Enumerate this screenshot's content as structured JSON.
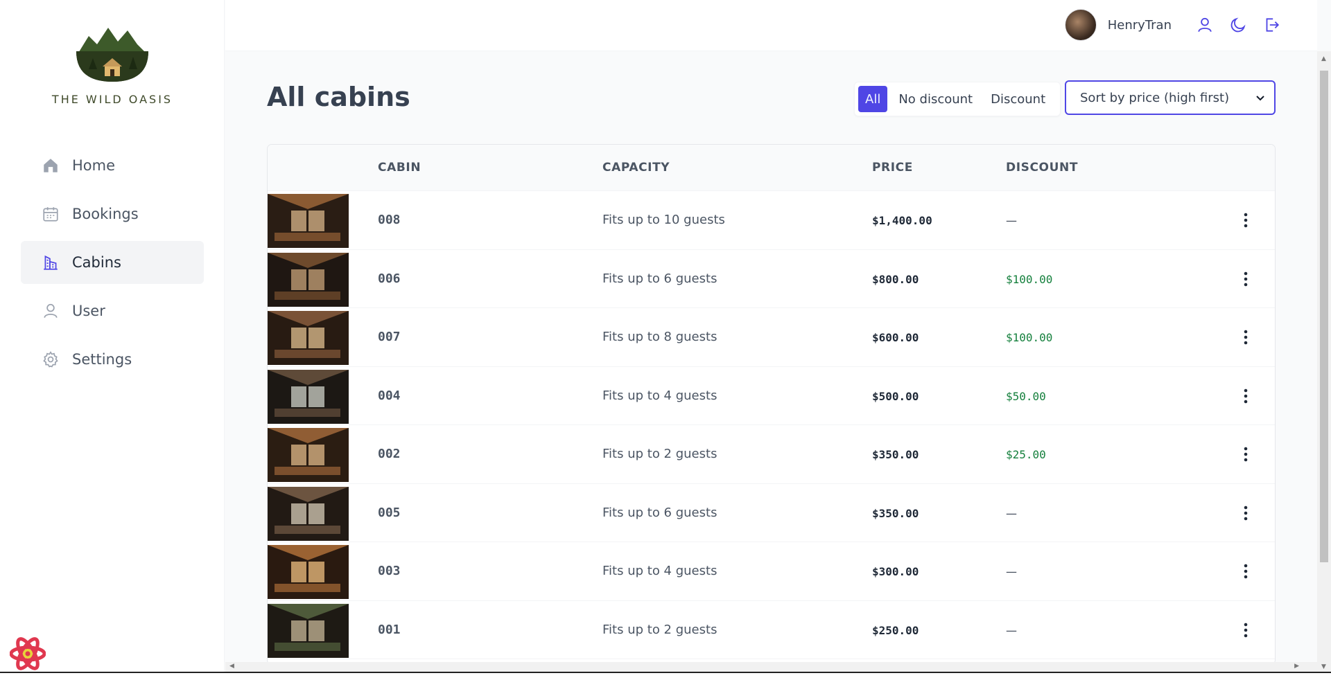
{
  "brand": {
    "name": "THE WILD OASIS"
  },
  "sidebar": {
    "items": [
      {
        "label": "Home",
        "icon": "home-icon"
      },
      {
        "label": "Bookings",
        "icon": "calendar-icon"
      },
      {
        "label": "Cabins",
        "icon": "building-icon",
        "active": true
      },
      {
        "label": "User",
        "icon": "user-icon"
      },
      {
        "label": "Settings",
        "icon": "gear-icon"
      }
    ]
  },
  "header": {
    "username": "HenryTran",
    "buttons": [
      "user-icon",
      "moon-icon",
      "logout-icon"
    ]
  },
  "main": {
    "title": "All cabins",
    "filter": {
      "options": [
        "All",
        "No discount",
        "Discount"
      ],
      "active": "All"
    },
    "sort": {
      "selected": "Sort by price (high first)"
    },
    "table": {
      "headers": [
        "CABIN",
        "CAPACITY",
        "PRICE",
        "DISCOUNT"
      ],
      "rows": [
        {
          "name": "008",
          "capacity": "Fits up to 10 guests",
          "price": "$1,400.00",
          "discount": "—"
        },
        {
          "name": "006",
          "capacity": "Fits up to 6 guests",
          "price": "$800.00",
          "discount": "$100.00"
        },
        {
          "name": "007",
          "capacity": "Fits up to 8 guests",
          "price": "$600.00",
          "discount": "$100.00"
        },
        {
          "name": "004",
          "capacity": "Fits up to 4 guests",
          "price": "$500.00",
          "discount": "$50.00"
        },
        {
          "name": "002",
          "capacity": "Fits up to 2 guests",
          "price": "$350.00",
          "discount": "$25.00"
        },
        {
          "name": "005",
          "capacity": "Fits up to 6 guests",
          "price": "$350.00",
          "discount": "—"
        },
        {
          "name": "003",
          "capacity": "Fits up to 4 guests",
          "price": "$300.00",
          "discount": "—"
        },
        {
          "name": "001",
          "capacity": "Fits up to 2 guests",
          "price": "$250.00",
          "discount": "—"
        }
      ]
    }
  },
  "colors": {
    "accent": "#4f46e5",
    "discount": "#15803d",
    "text": "#374151"
  }
}
